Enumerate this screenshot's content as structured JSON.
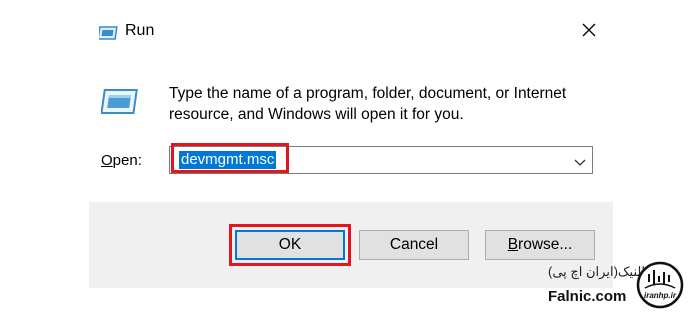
{
  "window": {
    "title": "Run",
    "title_icon": "run-icon",
    "close_icon": "close-icon"
  },
  "body": {
    "icon": "run-large-icon",
    "description_line1": "Type the name of a program, folder, document, or Internet",
    "description_line2": "resource, and Windows will open it for you."
  },
  "open": {
    "label_prefix": "O",
    "label_rest": "pen:",
    "value": "devmgmt.msc",
    "dropdown_icon": "chevron-down-icon"
  },
  "buttons": {
    "ok": "OK",
    "cancel": "Cancel",
    "browse_prefix": "B",
    "browse_rest": "rowse..."
  },
  "watermark": {
    "persian_text": "فالنیک(ایران اچ پی)",
    "site": "Falnic.com",
    "logo_text": "iranhp.ir"
  },
  "colors": {
    "highlight": "#e4151f",
    "selection": "#0078d7",
    "footer_bg": "#f0f0f0"
  }
}
